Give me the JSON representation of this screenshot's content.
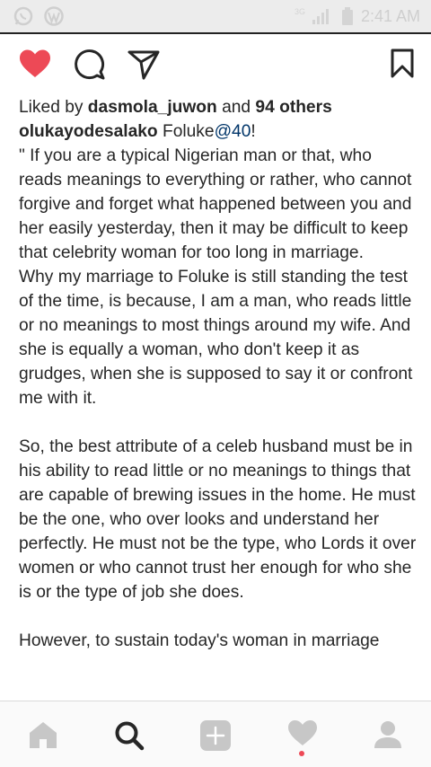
{
  "status_bar": {
    "time": "2:41 AM",
    "network": "3G",
    "icons": [
      "whatsapp-icon",
      "wordpress-icon",
      "signal-icon",
      "battery-icon"
    ]
  },
  "actions": {
    "icons": [
      "heart-filled-icon",
      "comment-icon",
      "direct-share-icon",
      "bookmark-icon"
    ],
    "like_color": "#ed4956"
  },
  "post": {
    "likes_prefix": "Liked by ",
    "likes_user": "dasmola_juwon",
    "likes_and": " and ",
    "likes_others": "94 others",
    "username": "olukayodesalako",
    "caption_start": " Foluke",
    "mention": "@40",
    "caption_end": "!",
    "paragraph_1": "\" If you are a typical Nigerian man or that, who reads meanings to everything or rather, who cannot forgive and forget what happened between you and her easily yesterday, then it may be difficult to keep that celebrity woman for too long in marriage.",
    "paragraph_2": "Why my marriage to Foluke is still standing the test of the time, is because, I am a man, who reads little or no meanings to most things around my wife. And she is equally a woman, who don't keep it as grudges, when she is supposed to say it or confront me with it.",
    "paragraph_3": "So, the best attribute of a celeb husband must be in his ability to read little or no meanings to things that are capable of brewing issues in the home. He must be the one, who over looks and understand her perfectly. He must not be the type, who Lords it over women or who cannot trust her enough for who she is or the type of job she does.",
    "paragraph_4": "However, to sustain today's woman in marriage"
  },
  "bottom_nav": {
    "items": [
      "home-icon",
      "search-icon",
      "add-post-icon",
      "activity-heart-icon",
      "profile-icon"
    ],
    "notification_color": "#ed4956"
  }
}
